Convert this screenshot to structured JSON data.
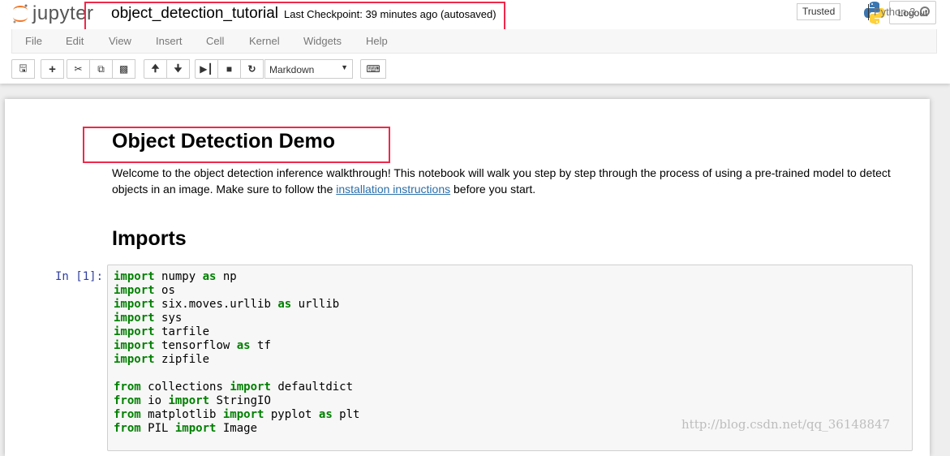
{
  "header": {
    "logo_text": "jupyter",
    "notebook_name": "object_detection_tutorial",
    "checkpoint": "Last Checkpoint: 39 minutes ago (autosaved)",
    "logout_label": "Logout"
  },
  "menu": {
    "items": [
      "File",
      "Edit",
      "View",
      "Insert",
      "Cell",
      "Kernel",
      "Widgets",
      "Help"
    ],
    "trusted": "Trusted",
    "kernel_name": "Python 3"
  },
  "toolbar": {
    "cell_type": "Markdown",
    "buttons": [
      "save-icon",
      "plus-icon",
      "cut-icon",
      "copy-icon",
      "paste-icon",
      "arrow-up-icon",
      "arrow-down-icon",
      "step-forward-icon",
      "stop-icon",
      "refresh-icon",
      "keyboard-icon"
    ]
  },
  "notebook": {
    "heading1": "Object Detection Demo",
    "intro_before": "Welcome to the object detection inference walkthrough! This notebook will walk you step by step through the process of using a pre-trained model to detect objects in an image. Make sure to follow the ",
    "intro_link": "installation instructions",
    "intro_after": " before you start.",
    "heading2": "Imports",
    "prompt": "In [1]:",
    "code_lines": [
      [
        [
          "kw",
          "import"
        ],
        [
          "",
          "numpy "
        ],
        [
          "kw",
          "as"
        ],
        [
          "",
          " np"
        ]
      ],
      [
        [
          "kw",
          "import"
        ],
        [
          "",
          "os"
        ]
      ],
      [
        [
          "kw",
          "import"
        ],
        [
          "",
          "six.moves.urllib "
        ],
        [
          "kw",
          "as"
        ],
        [
          "",
          " urllib"
        ]
      ],
      [
        [
          "kw",
          "import"
        ],
        [
          "",
          "sys"
        ]
      ],
      [
        [
          "kw",
          "import"
        ],
        [
          "",
          "tarfile"
        ]
      ],
      [
        [
          "kw",
          "import"
        ],
        [
          "",
          "tensorflow "
        ],
        [
          "kw",
          "as"
        ],
        [
          "",
          " tf"
        ]
      ],
      [
        [
          "kw",
          "import"
        ],
        [
          "",
          "zipfile"
        ]
      ],
      [],
      [
        [
          "kw",
          "from"
        ],
        [
          "",
          "collections "
        ],
        [
          "kw",
          "import"
        ],
        [
          "",
          " defaultdict"
        ]
      ],
      [
        [
          "kw",
          "from"
        ],
        [
          "",
          "io "
        ],
        [
          "kw",
          "import"
        ],
        [
          "",
          " StringIO"
        ]
      ],
      [
        [
          "kw",
          "from"
        ],
        [
          "",
          "matplotlib "
        ],
        [
          "kw",
          "import"
        ],
        [
          "",
          " pyplot "
        ],
        [
          "kw",
          "as"
        ],
        [
          "",
          " plt"
        ]
      ],
      [
        [
          "kw",
          "from"
        ],
        [
          "",
          "PIL "
        ],
        [
          "kw",
          "import"
        ],
        [
          "",
          " Image"
        ]
      ]
    ]
  },
  "watermark": "http://blog.csdn.net/qq_36148847",
  "colors": {
    "highlight_box": "#f0284a",
    "keyword": "#008000",
    "link": "#296eaa",
    "prompt": "#303f9f"
  }
}
